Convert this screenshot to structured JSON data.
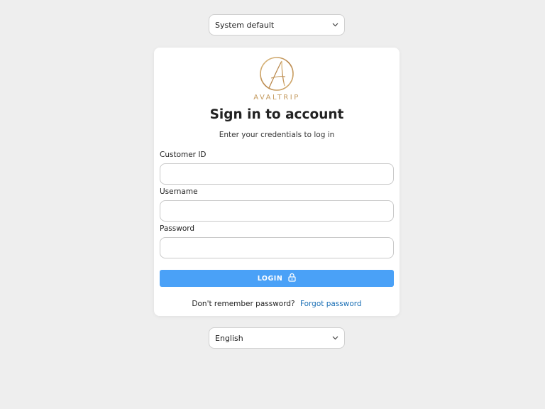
{
  "theme_select": {
    "value": "System default"
  },
  "brand": {
    "logo_text": "AVALTRIP",
    "accent": "#c49a5e"
  },
  "form": {
    "title": "Sign in to account",
    "subtitle": "Enter your credentials to log in",
    "fields": [
      {
        "label": "Customer ID",
        "value": "",
        "placeholder": ""
      },
      {
        "label": "Username",
        "value": "",
        "placeholder": ""
      },
      {
        "label": "Password",
        "value": "",
        "placeholder": ""
      }
    ],
    "login_label": "LOGIN",
    "login_icon": "lock-icon",
    "login_color": "#4aa1f7",
    "forgot_prompt": "Don't remember password?",
    "forgot_link": "Forgot password"
  },
  "language_select": {
    "value": "English"
  }
}
